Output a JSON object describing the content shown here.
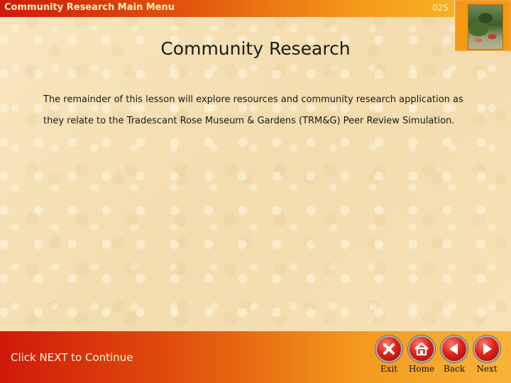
{
  "header": {
    "title": "Community Research Main Menu",
    "page_number": "025"
  },
  "main": {
    "heading": "Community Research",
    "paragraph": "The remainder of this lesson will explore resources and community research application as they relate to the Tradescant Rose Museum & Gardens (TRM&G) Peer Review Simulation."
  },
  "footer": {
    "continue_text": "Click NEXT to Continue",
    "buttons": {
      "exit": {
        "label": "Exit",
        "icon": "close-icon"
      },
      "home": {
        "label": "Home",
        "icon": "home-icon"
      },
      "back": {
        "label": "Back",
        "icon": "arrow-left-icon"
      },
      "next": {
        "label": "Next",
        "icon": "arrow-right-icon"
      }
    }
  },
  "colors": {
    "background": "#f6e2b6",
    "bar_start": "#ce1a0a",
    "bar_end": "#f8b023",
    "button_red": "#e0231b",
    "photo_frame": "#f59812"
  }
}
